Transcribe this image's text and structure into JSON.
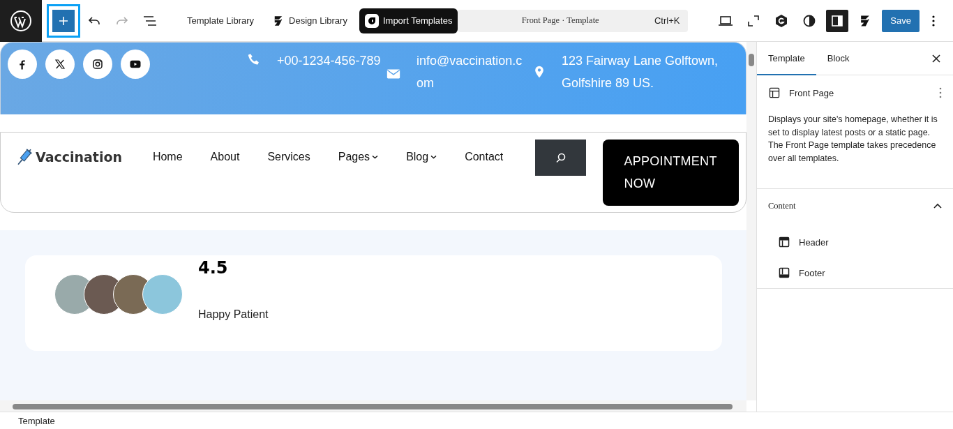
{
  "toolbar": {
    "inserter_active": true,
    "links": [
      {
        "label": "Template Library",
        "kind": "plain"
      },
      {
        "label": "Design Library",
        "kind": "design"
      },
      {
        "label": "Import Templates",
        "kind": "import"
      }
    ],
    "command": {
      "title": "Front Page · Template",
      "shortcut": "Ctrl+K"
    },
    "sidebar_toggle_on": true,
    "save": "Save"
  },
  "site": {
    "social": [
      {
        "kind": "facebook"
      },
      {
        "kind": "x"
      },
      {
        "kind": "instagram"
      },
      {
        "kind": "youtube"
      }
    ],
    "contacts": [
      {
        "kind": "phone",
        "text": "+00-1234-456-789"
      },
      {
        "kind": "email",
        "text": "info@vaccination.com"
      },
      {
        "kind": "location",
        "text": "123 Fairway Lane Golftown, Golfshire 89 US."
      }
    ],
    "logo": "Vaccination",
    "menu": [
      {
        "label": "Home",
        "dropdown": false
      },
      {
        "label": "About",
        "dropdown": false
      },
      {
        "label": "Services",
        "dropdown": false
      },
      {
        "label": "Pages",
        "dropdown": true
      },
      {
        "label": "Blog",
        "dropdown": true
      },
      {
        "label": "Contact",
        "dropdown": false
      }
    ],
    "appointment": "APPOINTMENT NOW",
    "rating": "4.5",
    "rating_label": "Happy Patient"
  },
  "panel": {
    "tabs": [
      {
        "label": "Template",
        "selected": true
      },
      {
        "label": "Block",
        "selected": false
      }
    ],
    "template": {
      "title": "Front Page",
      "description": "Displays your site's homepage, whether it is set to display latest posts or a static page. The Front Page template takes precedence over all templates."
    },
    "content": {
      "title": "Content",
      "expanded": true,
      "items": [
        {
          "label": "Header",
          "kind": "header"
        },
        {
          "label": "Footer",
          "kind": "footer"
        }
      ]
    }
  },
  "status_bar": {
    "breadcrumb": "Template"
  }
}
